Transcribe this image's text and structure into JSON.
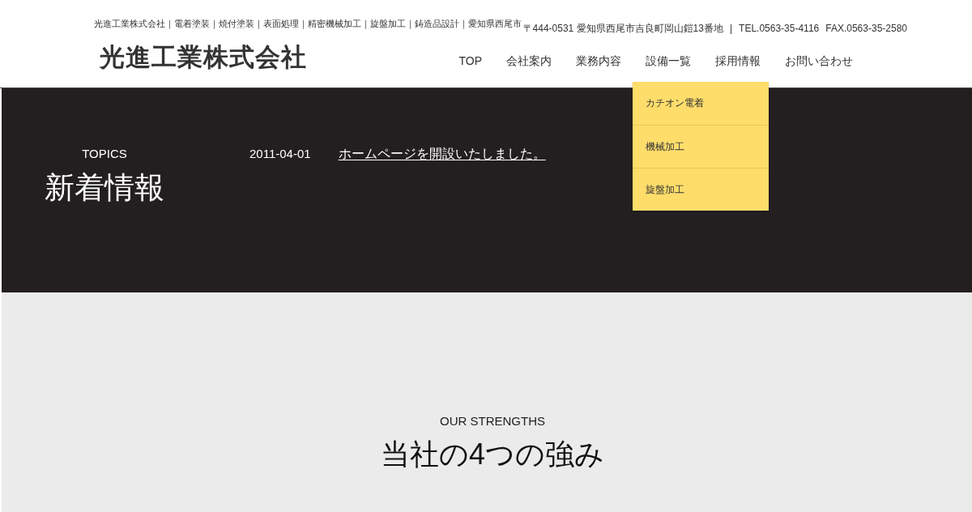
{
  "header": {
    "tagline": "光進工業株式会社｜電着塗装｜焼付塗装｜表面処理｜精密機械加工｜旋盤加工｜鋳造品設計｜愛知県西尾市",
    "address": "〒444-0531 愛知県西尾市吉良町岡山鎧13番地",
    "separator": "|",
    "tel": "TEL.0563-35-4116",
    "fax": "FAX.0563-35-2580",
    "logo": "光進工業株式会社"
  },
  "nav": {
    "items": [
      {
        "label": "TOP"
      },
      {
        "label": "会社案内"
      },
      {
        "label": "業務内容"
      },
      {
        "label": "設備一覧",
        "submenu": [
          {
            "label": "カチオン電着"
          },
          {
            "label": "機械加工"
          },
          {
            "label": "旋盤加工"
          }
        ]
      },
      {
        "label": "採用情報"
      },
      {
        "label": "お問い合わせ"
      }
    ]
  },
  "topics": {
    "eyebrow": "TOPICS",
    "title": "新着情報",
    "news": [
      {
        "date": "2011-04-01",
        "title": "ホームページを開設いたしました。"
      }
    ]
  },
  "strengths": {
    "eyebrow": "OUR STRENGTHS",
    "title": "当社の4つの強み"
  }
}
